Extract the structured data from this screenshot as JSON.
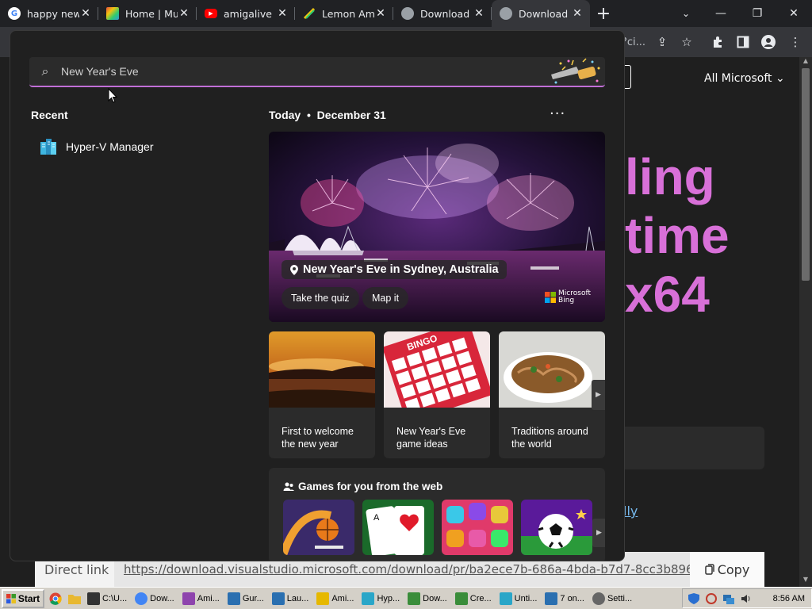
{
  "tabs": [
    {
      "title": "happy new",
      "favicon": "google-icon",
      "color": "#4285f4"
    },
    {
      "title": "Home | Mu",
      "favicon": "colorful-app-icon",
      "color": "#8e44ad"
    },
    {
      "title": "amigalive",
      "favicon": "youtube-icon",
      "color": "#ff0000"
    },
    {
      "title": "Lemon Am",
      "favicon": "lemon-icon",
      "color": "#f1c40f"
    },
    {
      "title": "Download",
      "favicon": "globe-icon",
      "color": "#9aa0a6"
    },
    {
      "title": "Download",
      "favicon": "globe-icon",
      "color": "#9aa0a6",
      "active": true
    }
  ],
  "browser": {
    "new_tab": "+",
    "omnibox_tail": "?ci...",
    "minimize": "—",
    "restore": "❐",
    "close": "✕"
  },
  "webpage": {
    "nav_all_microsoft": "All Microsoft ⌄",
    "hero_lines": [
      "ling",
      "time",
      "x64"
    ],
    "link_tail": "lly",
    "accent_color": "#d870d8"
  },
  "linkbar": {
    "label": "Direct link",
    "url": "https://download.visualstudio.microsoft.com/download/pr/ba2ece7b-686a-4bda-b7d7-8cc3b896",
    "copy_label": "Copy"
  },
  "flyout": {
    "search_value": "New Year's Eve",
    "recent_heading": "Recent",
    "recent_items": [
      {
        "label": "Hyper-V Manager"
      }
    ],
    "today_label": "Today",
    "date_label": "December 31",
    "more": "···",
    "hero": {
      "caption": "New Year's Eve in Sydney, Australia",
      "btn_quiz": "Take the quiz",
      "btn_map": "Map it",
      "bing_line1": "Microsoft",
      "bing_line2": "Bing"
    },
    "cards": [
      {
        "line1": "First to welcome",
        "line2": "the new year"
      },
      {
        "line1": "New Year's Eve",
        "line2": "game ideas"
      },
      {
        "line1": "Traditions around",
        "line2": "the world"
      }
    ],
    "games_heading": "Games for you from the web"
  },
  "taskbar": {
    "start": "Start",
    "tasks": [
      {
        "label": "C:\\U...",
        "color": "#333"
      },
      {
        "label": "Dow...",
        "color": "#4285f4"
      },
      {
        "label": "Ami...",
        "color": "#8e44ad"
      },
      {
        "label": "Gur...",
        "color": "#2a6fb0"
      },
      {
        "label": "Lau...",
        "color": "#2a6fb0"
      },
      {
        "label": "Ami...",
        "color": "#e6b800"
      },
      {
        "label": "Hyp...",
        "color": "#2aa6c8"
      },
      {
        "label": "Dow...",
        "color": "#3a8d3a"
      },
      {
        "label": "Cre...",
        "color": "#3a8d3a"
      },
      {
        "label": "Unti...",
        "color": "#2aa6c8"
      },
      {
        "label": "7 on...",
        "color": "#2a6fb0"
      },
      {
        "label": "Setti...",
        "color": "#666"
      }
    ],
    "clock": "8:56 AM"
  }
}
